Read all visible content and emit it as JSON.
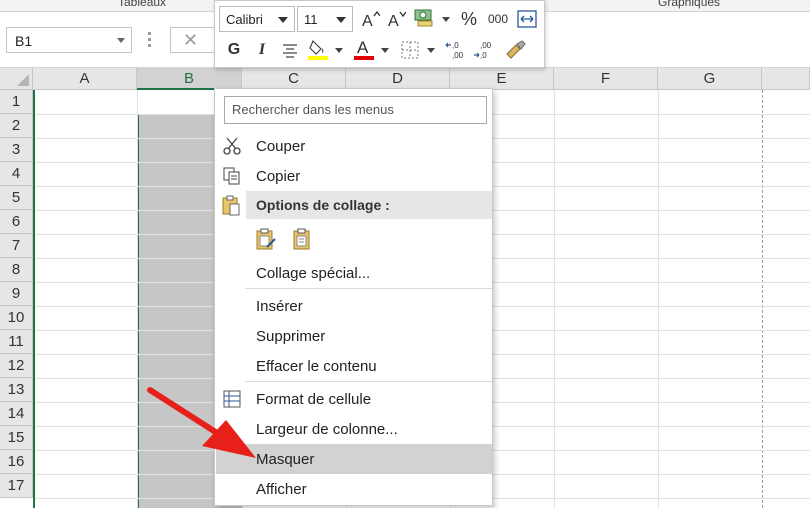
{
  "ribbon": {
    "group_left": "Tableaux",
    "group_right": "Graphiques"
  },
  "formula_bar": {
    "name_box": "B1",
    "cancel_glyph": "✕"
  },
  "mini_toolbar": {
    "font_name": "Calibri",
    "font_size": "11",
    "bold_label": "G",
    "italic_label": "I",
    "percent_label": "%",
    "thousands_label": "000",
    "fill_color": "#ffff00",
    "font_color": "#e00000"
  },
  "columns": [
    "A",
    "B",
    "C",
    "D",
    "E",
    "F",
    "G"
  ],
  "rows": [
    "1",
    "2",
    "3",
    "4",
    "5",
    "6",
    "7",
    "8",
    "9",
    "10",
    "11",
    "12",
    "13",
    "14",
    "15",
    "16",
    "17"
  ],
  "selected_column": "B",
  "context_menu": {
    "search_placeholder": "Rechercher dans les menus",
    "cut": "Couper",
    "copy": "Copier",
    "paste_options": "Options de collage :",
    "paste_special": "Collage spécial...",
    "insert": "Insérer",
    "delete": "Supprimer",
    "clear": "Effacer le contenu",
    "format_cells": "Format de cellule",
    "column_width": "Largeur de colonne...",
    "hide": "Masquer",
    "unhide": "Afficher"
  },
  "colors": {
    "accent_green": "#217346",
    "annotation_red": "#e8201a"
  }
}
